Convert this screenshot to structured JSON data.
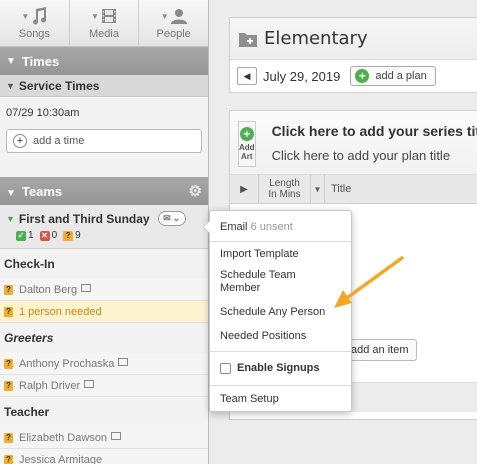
{
  "nav": {
    "items": [
      {
        "label": "Songs",
        "icon": "music-note-icon"
      },
      {
        "label": "Media",
        "icon": "film-icon"
      },
      {
        "label": "People",
        "icon": "person-icon"
      }
    ]
  },
  "times": {
    "header": "Times",
    "subheader": "Service Times",
    "entry": "07/29 10:30am",
    "add_label": "add a time"
  },
  "teams": {
    "header": "Teams",
    "team_name": "First and Third Sunday",
    "counts": {
      "confirmed": "1",
      "declined": "0",
      "unconfirmed": "9"
    },
    "groups": [
      {
        "name": "Check-In",
        "people": [
          "Dalton Berg",
          "1 person needed"
        ]
      },
      {
        "name": "Greeters",
        "people": [
          "Anthony Prochaska",
          "Ralph Driver"
        ]
      },
      {
        "name": "Teacher",
        "people": [
          "Elizabeth Dawson",
          "Jessica Armitage"
        ]
      }
    ]
  },
  "plan": {
    "title": "Elementary",
    "date": "July 29, 2019",
    "add_plan_label": "add a plan",
    "series_title": "Click here to add your series title",
    "series_subtitle": "Click here to add your plan title",
    "add_art_label_1": "Add",
    "add_art_label_2": "Art",
    "col_length_1": "Length",
    "col_length_2": "In Mins",
    "col_title": "Title",
    "add_item_label": "add an item"
  },
  "menu": {
    "email_label": "Email",
    "email_unsent": "6 unsent",
    "import_template": "Import Template",
    "schedule_team_member_1": "Schedule Team",
    "schedule_team_member_2": "Member",
    "schedule_any_person": "Schedule Any Person",
    "needed_positions": "Needed Positions",
    "enable_signups": "Enable Signups",
    "team_setup": "Team Setup"
  },
  "colors": {
    "annotation_arrow": "#f5a623",
    "accent_green": "#4caf50"
  }
}
